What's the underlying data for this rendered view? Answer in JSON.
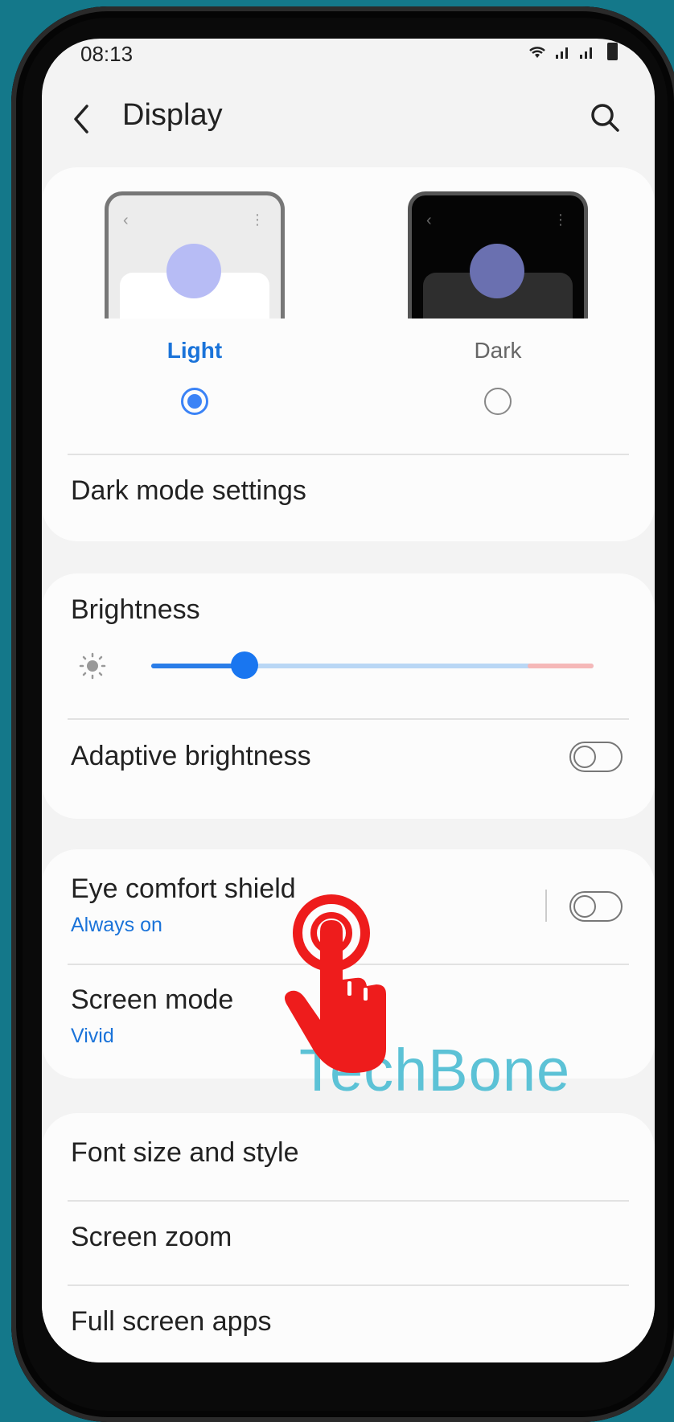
{
  "status": {
    "time": "08:13",
    "icons": "wifi signal signal battery"
  },
  "appbar": {
    "title": "Display"
  },
  "theme": {
    "light_label": "Light",
    "dark_label": "Dark",
    "selected": "Light"
  },
  "dark_mode_settings": {
    "label": "Dark mode settings"
  },
  "brightness": {
    "label": "Brightness",
    "level_percent": 21
  },
  "adaptive_brightness": {
    "label": "Adaptive brightness",
    "enabled": false
  },
  "eye_comfort": {
    "label": "Eye comfort shield",
    "value": "Always on",
    "enabled": false
  },
  "screen_mode": {
    "label": "Screen mode",
    "value": "Vivid"
  },
  "font": {
    "label": "Font size and style"
  },
  "zoom": {
    "label": "Screen zoom"
  },
  "fullscreen": {
    "label": "Full screen apps"
  },
  "watermark": "TechBone",
  "colors": {
    "accent": "#1a73d9",
    "background": "#14788a",
    "pointer": "#ee1c1c"
  }
}
